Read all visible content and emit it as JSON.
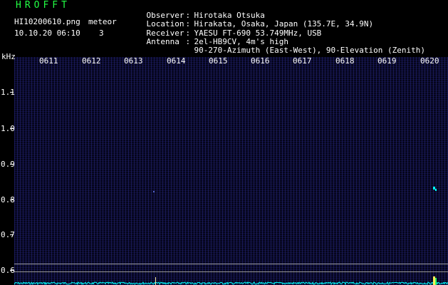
{
  "header": {
    "app_title": "HROFFT",
    "filename": "HI10200610.png",
    "datetime": "10.10.20 06:10",
    "count_label": "meteor",
    "count_value": "3"
  },
  "info": [
    {
      "label": "Observer",
      "value": "Hirotaka Otsuka"
    },
    {
      "label": "Location",
      "value": "Hirakata, Osaka, Japan (135.7E, 34.9N)"
    },
    {
      "label": "Receiver",
      "value": "YAESU FT-690 53.749MHz, USB"
    },
    {
      "label": "Antenna",
      "value": "2el-HB9CV, 4m's high"
    },
    {
      "label": "",
      "value": "90-270-Azimuth (East-West), 90-Elevation (Zenith)"
    }
  ],
  "plot": {
    "y_unit": "kHz",
    "y_ticks": [
      "1.1",
      "1.0",
      "0.9",
      "0.8",
      "0.7",
      "0.6"
    ],
    "x_ticks": [
      "0611",
      "0612",
      "0613",
      "0614",
      "0615",
      "0616",
      "0617",
      "0618",
      "0619",
      "0620"
    ],
    "background_color": "#05051a",
    "signal_color": "#00ffff"
  }
}
